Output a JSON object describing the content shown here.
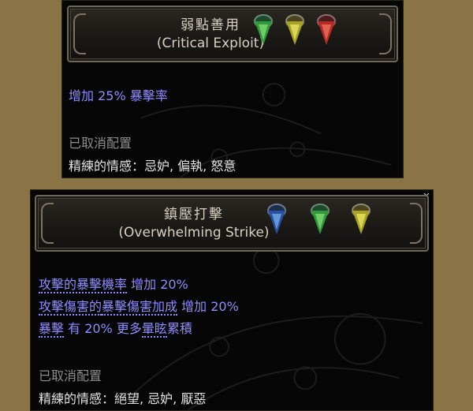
{
  "panel1": {
    "title_zh": "弱點善用",
    "title_en": "(Critical Exploit)",
    "stat": "增加 25% 暴擊率",
    "status": "已取消配置",
    "emotions_label": "精練的情感：忌妒, 偏執, 怒意",
    "gems": [
      "green-gem-icon",
      "yellow-gem-icon",
      "red-gem-icon"
    ]
  },
  "panel2": {
    "title_zh": "鎮壓打擊",
    "title_en": "(Overwhelming Strike)",
    "stats": {
      "s1_kw": "攻擊的暴擊機率",
      "s1_rest": "增加 20%",
      "s2_kw1": "攻擊傷害的",
      "s2_kw2": "暴擊傷害加成",
      "s2_rest": "增加 20%",
      "s3_kw": "暴擊",
      "s3_mid": "有 20% 更多",
      "s3_kw2": "暈眩",
      "s3_rest": "累積"
    },
    "status": "已取消配置",
    "emotions_label": "精練的情感：絕望, 忌妒, 厭惡",
    "gems": [
      "blue-gem-icon",
      "green-gem-icon",
      "yellow-gem-icon"
    ],
    "close_glyph": "✕"
  },
  "colors": {
    "background": "#8a7446",
    "stat_text": "#8f8cff",
    "status_text": "#8d8d8d",
    "emotion_text": "#e2e2e2",
    "title_text": "#d6d0c4"
  }
}
